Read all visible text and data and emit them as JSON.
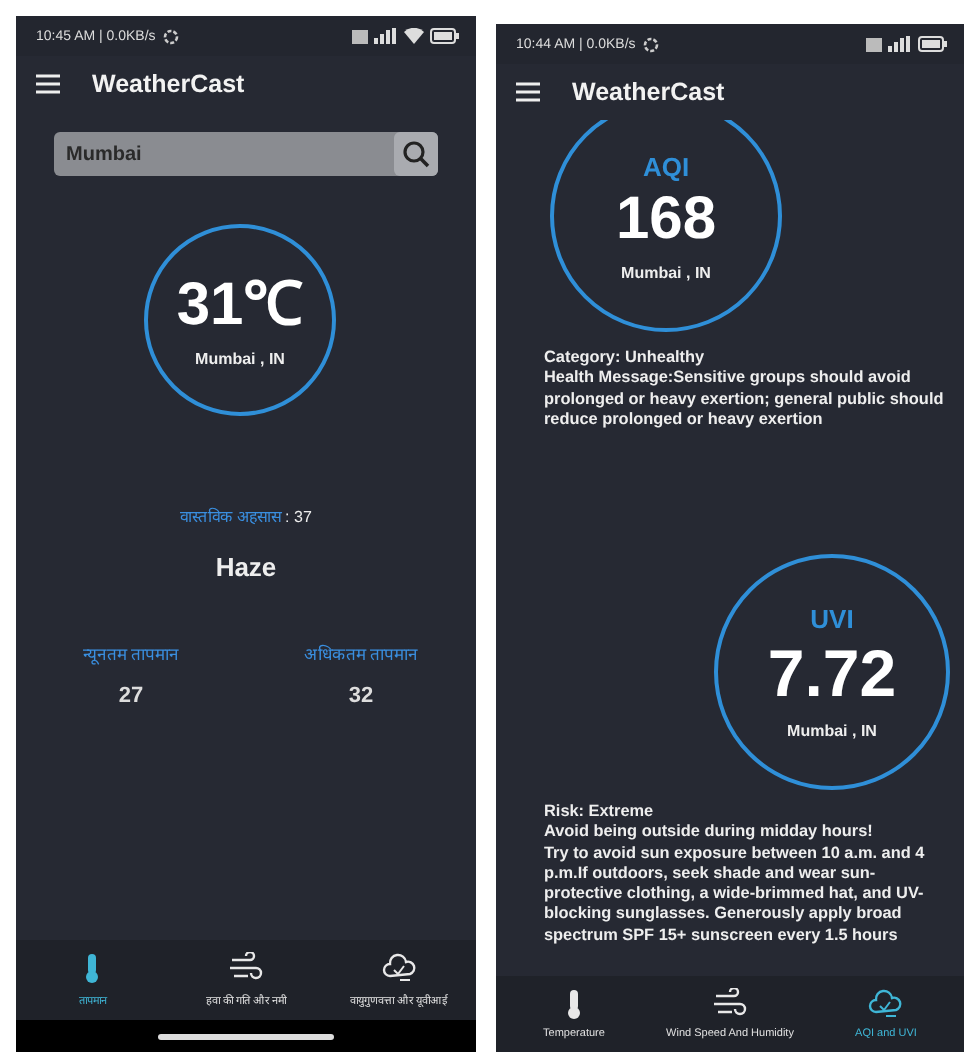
{
  "screens": [
    {
      "kind": "temperature",
      "status_bar": {
        "time": "10:45 AM | 0.0KB/s",
        "wifi": true
      },
      "app_bar": {
        "title": "WeatherCast"
      },
      "search": {
        "value": "Mumbai"
      },
      "reading": {
        "value": "31℃",
        "location": "Mumbai , IN"
      },
      "feels_like": {
        "label": "वास्तविक अहसास",
        "value": " : 37"
      },
      "condition": "Haze",
      "ranges": [
        {
          "label": "न्यूनतम तापमान",
          "value": "27"
        },
        {
          "label": "अधिकतम तापमान",
          "value": "32"
        }
      ],
      "nav": [
        {
          "label": "तापमान",
          "kind": "thermometer",
          "selected": true
        },
        {
          "label": "हवा की गति और नमी",
          "kind": "wind",
          "selected": false
        },
        {
          "label": "वायुगुणवत्ता और यूवीआई",
          "kind": "air",
          "selected": false
        }
      ]
    },
    {
      "kind": "aqi",
      "status_bar": {
        "time": "10:44 AM | 0.0KB/s",
        "wifi": false
      },
      "app_bar": {
        "title": "WeatherCast"
      },
      "aqi": {
        "title": "AQI",
        "value": "168",
        "location": "Mumbai , IN"
      },
      "aqi_text": [
        "Category: Unhealthy",
        "Health Message:Sensitive groups should avoid prolonged or heavy exertion; general public should reduce prolonged or heavy exertion"
      ],
      "uvi": {
        "title": "UVI",
        "value": "7.72",
        "location": "Mumbai , IN"
      },
      "uvi_text": [
        "Risk: Extreme",
        "Avoid being outside during midday hours!",
        "Try to avoid sun exposure between 10 a.m. and 4 p.m.If outdoors, seek shade and wear sun-protective clothing, a wide-brimmed hat, and UV-blocking sunglasses. Generously apply broad spectrum SPF 15+ sunscreen every 1.5 hours"
      ],
      "nav": [
        {
          "label": "Temperature",
          "kind": "thermometer",
          "selected": false
        },
        {
          "label": "Wind Speed And Humidity",
          "kind": "wind",
          "selected": false
        },
        {
          "label": "AQI and UVI",
          "kind": "air",
          "selected": true
        }
      ]
    }
  ]
}
